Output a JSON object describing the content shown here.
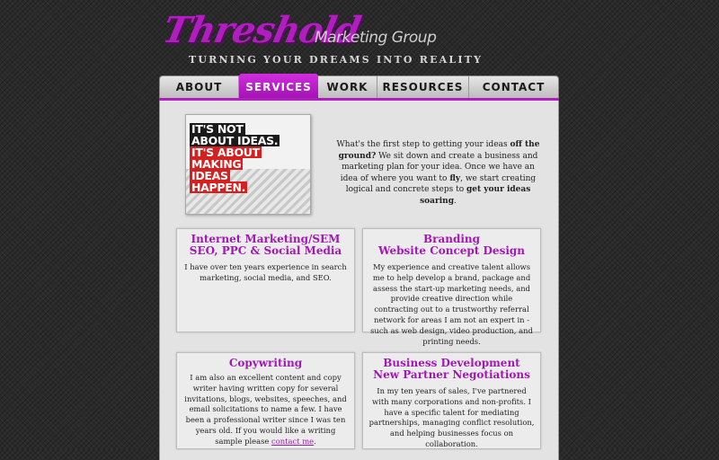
{
  "header": {
    "logo_main": "Threshold",
    "logo_sub": "Marketing Group",
    "tagline": "TURNING YOUR DREAMS INTO REALITY"
  },
  "nav": {
    "items": [
      {
        "label": "ABOUT"
      },
      {
        "label": "SERVICES"
      },
      {
        "label": "WORK"
      },
      {
        "label": "RESOURCES"
      },
      {
        "label": "CONTACT"
      }
    ],
    "active": "SERVICES"
  },
  "poster": {
    "lines": [
      "IT'S NOT",
      "ABOUT IDEAS.",
      "IT'S ABOUT",
      "MAKING",
      "IDEAS",
      "HAPPEN."
    ]
  },
  "intro": {
    "p1": "What's the first step to getting your ideas ",
    "b1": "off the ground?",
    "p2": " We sit down and create a business and marketing plan for your idea. Once we have an idea of where you want to ",
    "b2": "fly",
    "p3": ", we start creating logical and concrete steps to ",
    "b3": "get your ideas soaring",
    "p4": "."
  },
  "boxes": [
    {
      "title1": "Internet Marketing/SEM",
      "title2": "SEO, PPC & Social Media",
      "body": "I have over ten years experience in search marketing, social media, and SEO."
    },
    {
      "title1": "Branding",
      "title2": "Website Concept Design",
      "body": "My experience and creative talent allows me to help develop a brand, package and assess the start-up marketing needs, and provide creative direction while contracting out to a trustworthy referral network for areas I am not an expert in - such as web design, video production, and printing needs."
    },
    {
      "title1": "Copywriting",
      "body": "I am also an excellent content and copy writer having written copy for several invitations, blogs, websites, speeches, and email solicitations to name a few. I have been a professional writer since I was ten years old. If you would like a writing sample please ",
      "link": "contact me",
      "body_end": "."
    },
    {
      "title1": "Business Development",
      "title2": "New Partner Negotiations",
      "body": "In my ten years of sales, I've partnered with many corporations and non-profits. I have a specific talent for mediating partnerships, managing conflict resolution, and helping businesses focus on collaboration."
    }
  ],
  "colors": {
    "accent": "#b11ec0",
    "background": "#2a2a2a",
    "panel": "#e3e3e3"
  }
}
